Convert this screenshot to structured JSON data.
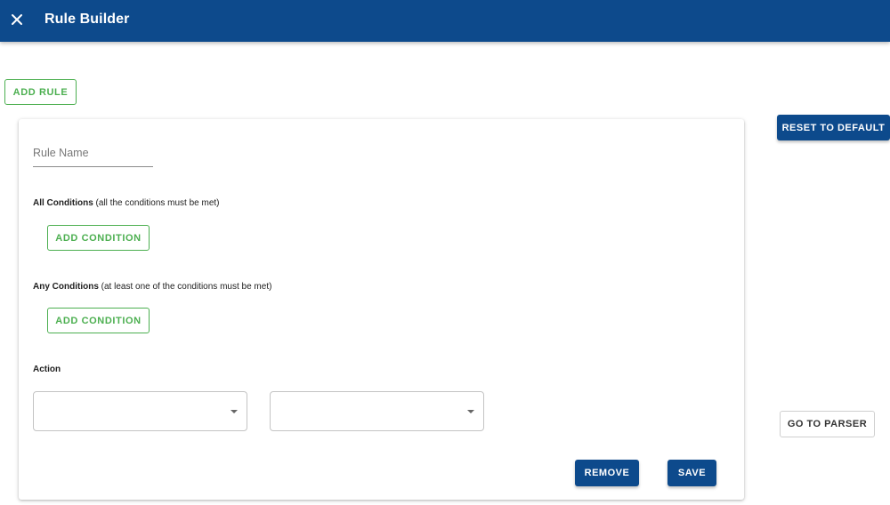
{
  "appbar": {
    "title": "Rule Builder",
    "close_icon": "close-icon"
  },
  "toolbar": {
    "add_rule_label": "ADD RULE",
    "reset_label": "RESET TO DEFAULT",
    "go_to_parser_label": "GO TO PARSER"
  },
  "rule_card": {
    "rule_name": {
      "value": "",
      "placeholder": "Rule Name"
    },
    "all_conditions": {
      "title": "All Conditions",
      "hint": " (all the conditions must be met)",
      "add_label": "ADD CONDITION"
    },
    "any_conditions": {
      "title": "Any Conditions",
      "hint": " (at least one of the conditions must be met)",
      "add_label": "ADD CONDITION"
    },
    "action": {
      "title": "Action",
      "select_1_value": "",
      "select_2_value": ""
    },
    "remove_label": "REMOVE",
    "save_label": "SAVE"
  },
  "colors": {
    "primary": "#0d4a8c",
    "accent_green": "#4caf50"
  }
}
